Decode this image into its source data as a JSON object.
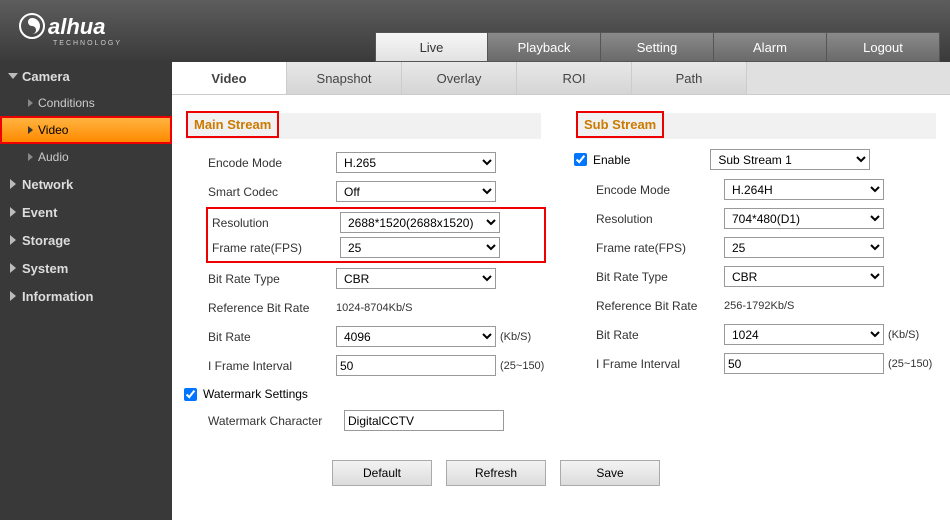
{
  "brand": {
    "name": "alhua",
    "sub": "TECHNOLOGY"
  },
  "topnav": {
    "live": "Live",
    "playback": "Playback",
    "setting": "Setting",
    "alarm": "Alarm",
    "logout": "Logout"
  },
  "sidebar": {
    "camera": {
      "label": "Camera",
      "conditions": "Conditions",
      "video": "Video",
      "audio": "Audio"
    },
    "network": "Network",
    "event": "Event",
    "storage": "Storage",
    "system": "System",
    "information": "Information"
  },
  "tabs": {
    "video": "Video",
    "snapshot": "Snapshot",
    "overlay": "Overlay",
    "roi": "ROI",
    "path": "Path"
  },
  "main_stream": {
    "title": "Main Stream",
    "encode_mode": {
      "label": "Encode Mode",
      "value": "H.265"
    },
    "smart_codec": {
      "label": "Smart Codec",
      "value": "Off"
    },
    "resolution": {
      "label": "Resolution",
      "value": "2688*1520(2688x1520)"
    },
    "fps": {
      "label": "Frame rate(FPS)",
      "value": "25"
    },
    "bitrate_type": {
      "label": "Bit Rate Type",
      "value": "CBR"
    },
    "ref_bitrate": {
      "label": "Reference Bit Rate",
      "value": "1024-8704Kb/S"
    },
    "bitrate": {
      "label": "Bit Rate",
      "value": "4096",
      "unit": "(Kb/S)"
    },
    "iframe": {
      "label": "I Frame Interval",
      "value": "50",
      "unit": "(25~150)"
    },
    "watermark": {
      "label": "Watermark Settings",
      "checked": true
    },
    "watermark_char": {
      "label": "Watermark Character",
      "value": "DigitalCCTV"
    }
  },
  "sub_stream": {
    "title": "Sub Stream",
    "enable": {
      "label": "Enable",
      "checked": true,
      "value": "Sub Stream 1"
    },
    "encode_mode": {
      "label": "Encode Mode",
      "value": "H.264H"
    },
    "resolution": {
      "label": "Resolution",
      "value": "704*480(D1)"
    },
    "fps": {
      "label": "Frame rate(FPS)",
      "value": "25"
    },
    "bitrate_type": {
      "label": "Bit Rate Type",
      "value": "CBR"
    },
    "ref_bitrate": {
      "label": "Reference Bit Rate",
      "value": "256-1792Kb/S"
    },
    "bitrate": {
      "label": "Bit Rate",
      "value": "1024",
      "unit": "(Kb/S)"
    },
    "iframe": {
      "label": "I Frame Interval",
      "value": "50",
      "unit": "(25~150)"
    }
  },
  "buttons": {
    "default": "Default",
    "refresh": "Refresh",
    "save": "Save"
  }
}
